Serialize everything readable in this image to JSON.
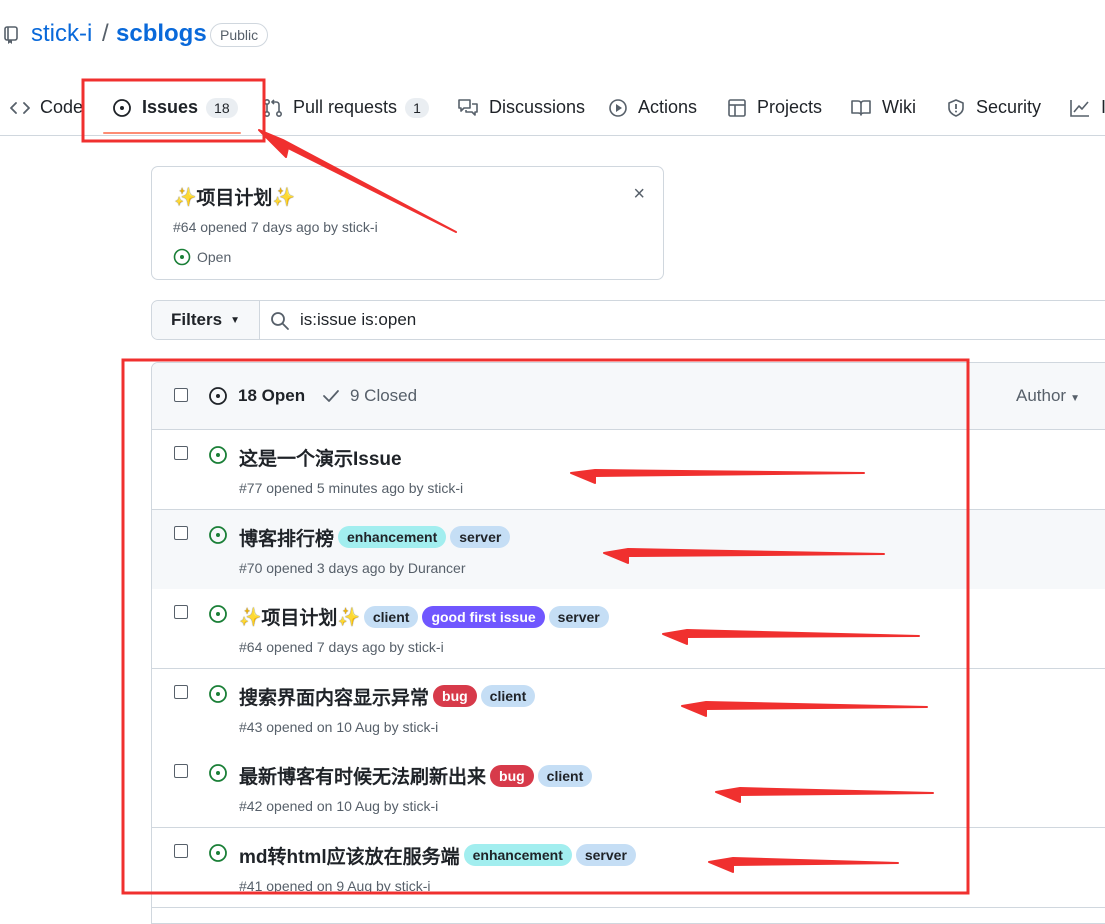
{
  "repo": {
    "owner": "stick-i",
    "separator": "/",
    "name": "scblogs",
    "visibility": "Public"
  },
  "tabs": [
    {
      "label": "Code",
      "icon": "code-icon"
    },
    {
      "label": "Issues",
      "icon": "issue-opened-icon",
      "count": "18",
      "selected": true
    },
    {
      "label": "Pull requests",
      "icon": "git-pull-request-icon",
      "count": "1"
    },
    {
      "label": "Discussions",
      "icon": "comment-discussion-icon"
    },
    {
      "label": "Actions",
      "icon": "play-icon"
    },
    {
      "label": "Projects",
      "icon": "table-icon"
    },
    {
      "label": "Wiki",
      "icon": "book-icon"
    },
    {
      "label": "Security",
      "icon": "shield-icon"
    },
    {
      "label": "I",
      "icon": "graph-icon"
    }
  ],
  "pinned": {
    "title": "项目计划",
    "meta": "#64 opened 7 days ago by stick-i",
    "state": "Open",
    "close": "×"
  },
  "filters": {
    "button_label": "Filters",
    "search_value": "is:issue is:open"
  },
  "list_header": {
    "open_label": "18 Open",
    "closed_label": "9 Closed",
    "author_label": "Author"
  },
  "issues": [
    {
      "title": "这是一个演示Issue",
      "meta": "#77 opened 5 minutes ago by stick-i",
      "labels": [],
      "sparkles": false
    },
    {
      "title": "博客排行榜",
      "meta": "#70 opened 3 days ago by Durancer",
      "labels": [
        {
          "name": "enhancement",
          "bg": "#a2eeef",
          "fg": "#1f2328"
        },
        {
          "name": "server",
          "bg": "#c5def5",
          "fg": "#1f2328"
        }
      ],
      "sparkles": false
    },
    {
      "title": "项目计划",
      "meta": "#64 opened 7 days ago by stick-i",
      "labels": [
        {
          "name": "client",
          "bg": "#c5def5",
          "fg": "#1f2328"
        },
        {
          "name": "good first issue",
          "bg": "#7057ff",
          "fg": "#ffffff"
        },
        {
          "name": "server",
          "bg": "#c5def5",
          "fg": "#1f2328"
        }
      ],
      "sparkles": true
    },
    {
      "title": "搜索界面内容显示异常",
      "meta": "#43 opened on 10 Aug by stick-i",
      "labels": [
        {
          "name": "bug",
          "bg": "#d73a4a",
          "fg": "#ffffff"
        },
        {
          "name": "client",
          "bg": "#c5def5",
          "fg": "#1f2328"
        }
      ],
      "sparkles": false
    },
    {
      "title": "最新博客有时候无法刷新出来",
      "meta": "#42 opened on 10 Aug by stick-i",
      "labels": [
        {
          "name": "bug",
          "bg": "#d73a4a",
          "fg": "#ffffff"
        },
        {
          "name": "client",
          "bg": "#c5def5",
          "fg": "#1f2328"
        }
      ],
      "sparkles": false
    },
    {
      "title": "md转html应该放在服务端",
      "meta": "#41 opened on 9 Aug by stick-i",
      "labels": [
        {
          "name": "enhancement",
          "bg": "#a2eeef",
          "fg": "#1f2328"
        },
        {
          "name": "server",
          "bg": "#c5def5",
          "fg": "#1f2328"
        }
      ],
      "sparkles": false
    }
  ],
  "colors": {
    "link": "#0969da",
    "open_green": "#1a7f37",
    "annotation_red": "#f0302f",
    "tab_underline": "#fd8c73"
  }
}
